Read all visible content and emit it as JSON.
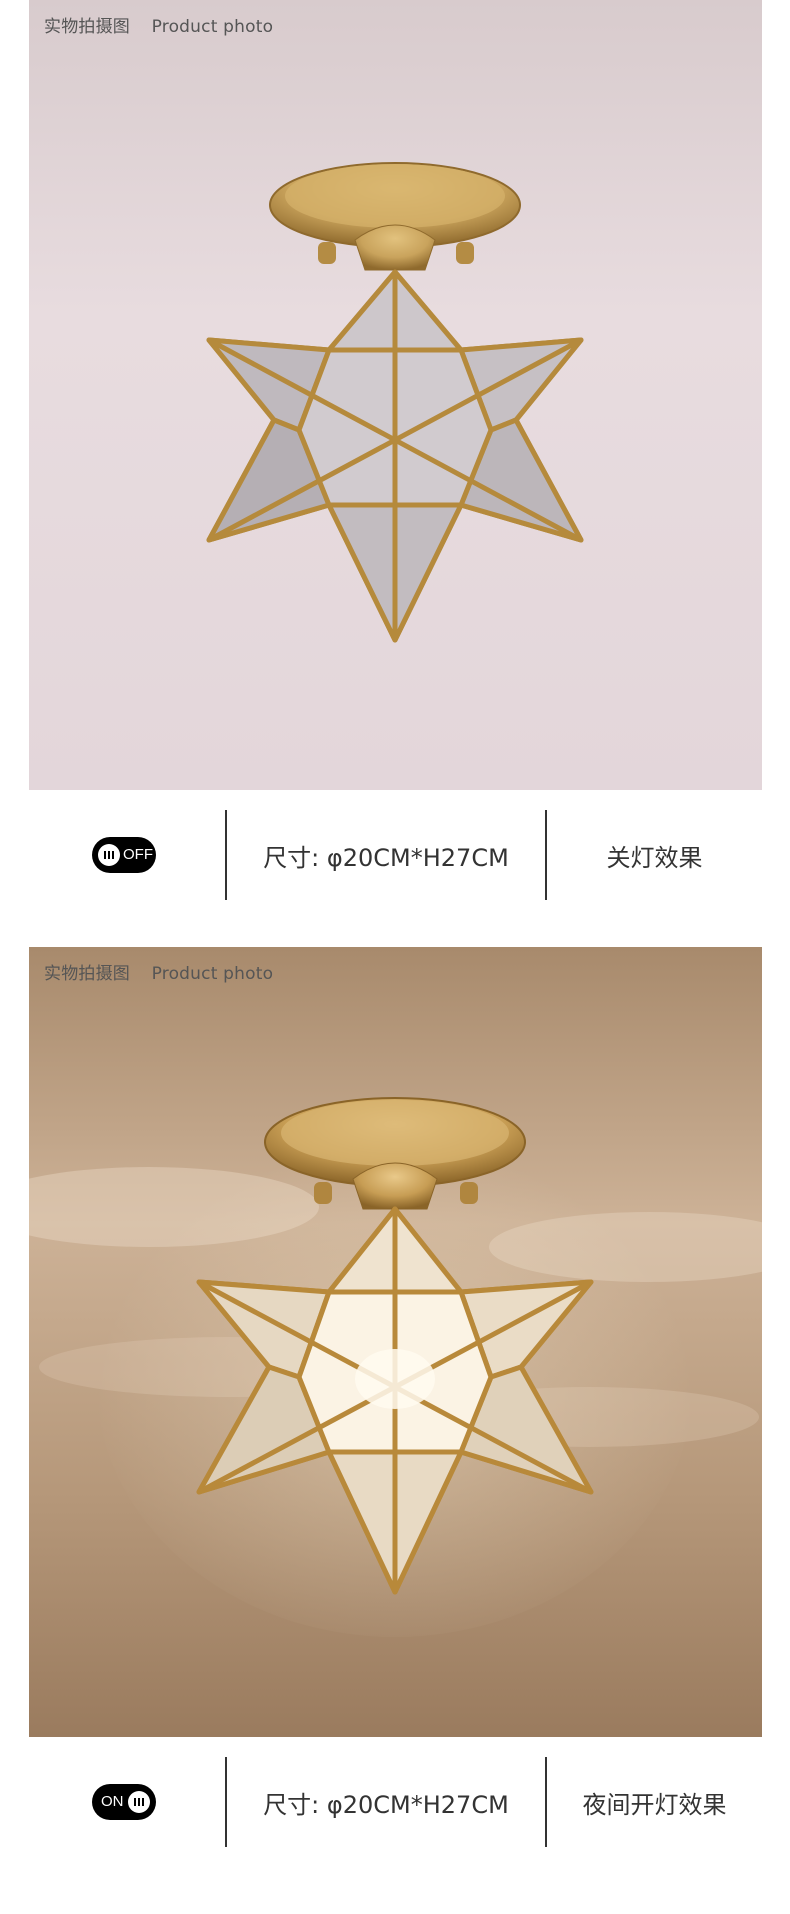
{
  "panels": [
    {
      "caption_cn": "实物拍摄图",
      "caption_en": "Product photo",
      "toggle_label": "OFF",
      "size_text": "尺寸: φ20CM*H27CM",
      "effect_text": "关灯效果"
    },
    {
      "caption_cn": "实物拍摄图",
      "caption_en": "Product photo",
      "toggle_label": "ON",
      "size_text": "尺寸: φ20CM*H27CM",
      "effect_text": "夜间开灯效果"
    }
  ],
  "colors": {
    "off_background": "#e7d9dc",
    "on_background": "#b89a7c",
    "brass": "#c9a35c",
    "brass_dark": "#9a7433",
    "glass": "#c9c3c6"
  },
  "icons": [
    "toggle-off-icon",
    "toggle-on-icon"
  ]
}
